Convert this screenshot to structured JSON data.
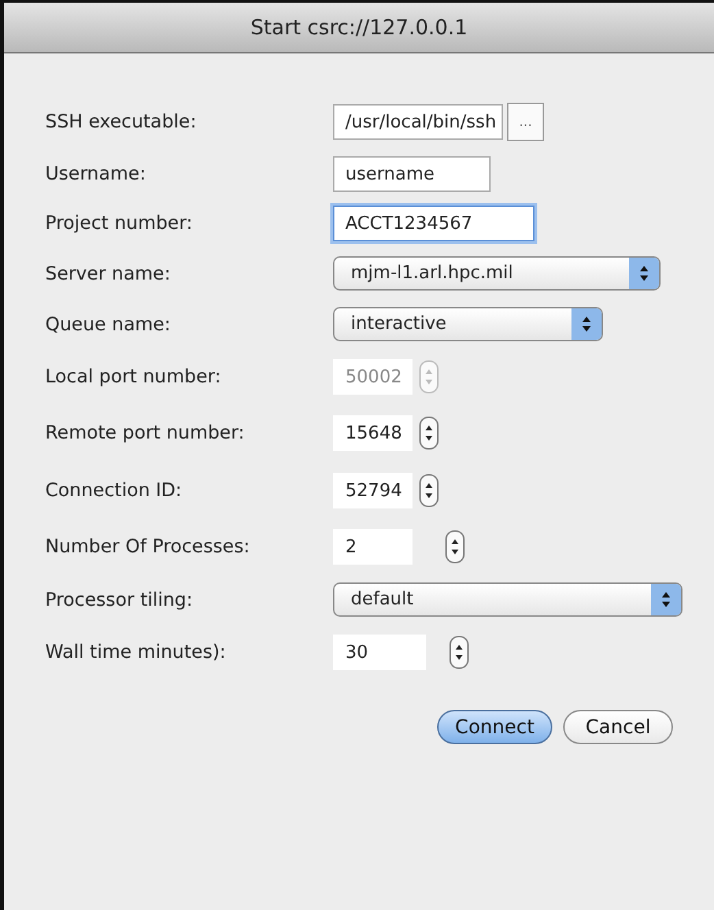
{
  "window": {
    "title": "Start csrc://127.0.0.1"
  },
  "fields": [
    {
      "kind": "browse",
      "label": "SSH executable:",
      "value": "/usr/local/bin/ssh",
      "button": "...",
      "focused": false,
      "disabled": false
    },
    {
      "kind": "text",
      "label": "Username:",
      "value": "username",
      "focused": false,
      "disabled": false
    },
    {
      "kind": "text",
      "label": "Project number:",
      "value": "ACCT1234567",
      "focused": true,
      "disabled": false
    },
    {
      "kind": "select",
      "label": "Server name:",
      "value": "mjm-l1.arl.hpc.mil",
      "focused": false,
      "disabled": false
    },
    {
      "kind": "select",
      "label": "Queue name:",
      "value": "interactive",
      "focused": false,
      "disabled": false
    },
    {
      "kind": "spinner",
      "label": "Local port number:",
      "value": "50002",
      "focused": false,
      "disabled": true
    },
    {
      "kind": "spinner",
      "label": "Remote port number:",
      "value": "15648",
      "focused": false,
      "disabled": false
    },
    {
      "kind": "spinner",
      "label": "Connection ID:",
      "value": "52794",
      "focused": false,
      "disabled": false
    },
    {
      "kind": "spinner",
      "label": "Number Of Processes:",
      "value": "2",
      "focused": false,
      "disabled": false
    },
    {
      "kind": "select",
      "label": "Processor tiling:",
      "value": "default",
      "focused": false,
      "disabled": false
    },
    {
      "kind": "spinner",
      "label": "Wall time minutes):",
      "value": "30",
      "focused": false,
      "disabled": false
    }
  ],
  "buttons": [
    {
      "label": "Connect",
      "default": true
    },
    {
      "label": "Cancel",
      "default": false
    }
  ]
}
